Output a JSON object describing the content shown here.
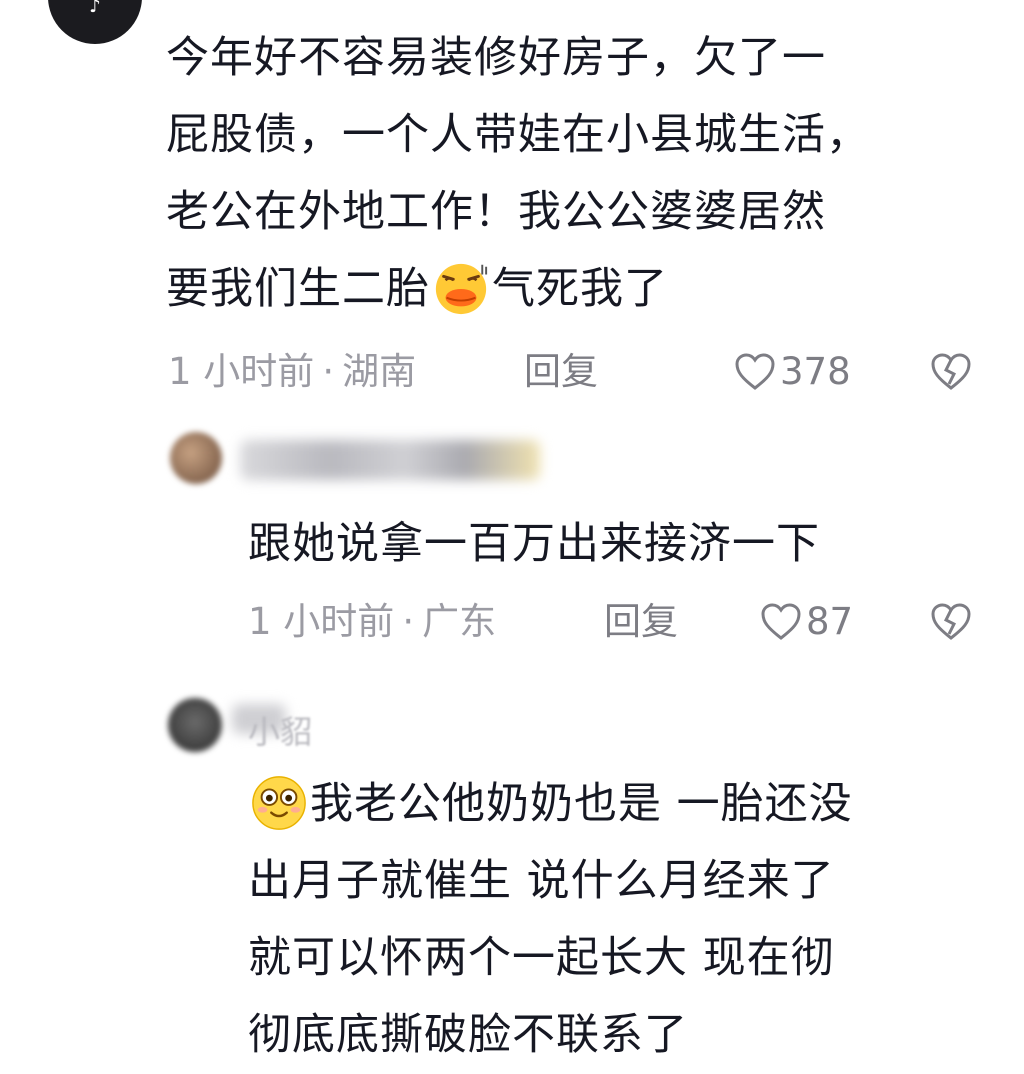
{
  "main_comment": {
    "lines": [
      "今年好不容易装修好房子，欠了一",
      "屁股债，一个人带娃在小县城生活，",
      "老公在外地工作！我公公婆婆居然",
      "要我们生二胎"
    ],
    "line4_tail": "气死我了",
    "emoji": "angry-duck-face-icon",
    "time": "1 小时前",
    "location": "湖南",
    "reply_label": "回复",
    "likes": "378"
  },
  "reply1": {
    "text": "跟她说拿一百万出来接济一下",
    "time": "1 小时前",
    "location": "广东",
    "reply_label": "回复",
    "likes": "87"
  },
  "reply2": {
    "name_fragment": "小貂",
    "emoji": "smiling-face-icon",
    "lines": [
      "我老公他奶奶也是 一胎还没",
      "出月子就催生 说什么月经来了",
      "就可以怀两个一起长大 现在彻",
      "彻底底撕破脸不联系了"
    ]
  },
  "colors": {
    "text": "#161823",
    "meta": "#9b9ba3",
    "background": "#ffffff"
  }
}
